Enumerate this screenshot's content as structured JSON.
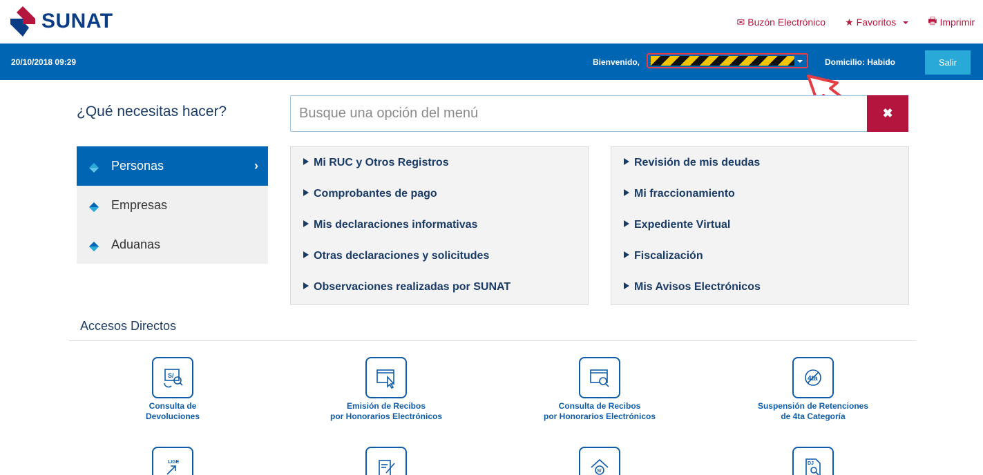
{
  "header": {
    "logo_text": "SUNAT",
    "links": {
      "buzon": "Buzón Electrónico",
      "favoritos": "Favoritos",
      "imprimir": "Imprimir"
    }
  },
  "bar": {
    "datetime": "20/10/2018 09:29",
    "welcome": "Bienvenido,",
    "domicilio": "Domicilio: Habido",
    "logout": "Salir"
  },
  "search": {
    "question": "¿Qué necesitas hacer?",
    "placeholder": "Busque una opción del menú",
    "clear_symbol": "✖"
  },
  "categories": [
    {
      "label": "Personas",
      "active": true
    },
    {
      "label": "Empresas",
      "active": false
    },
    {
      "label": "Aduanas",
      "active": false
    }
  ],
  "options_left": [
    "Mi RUC y Otros Registros",
    "Comprobantes de pago",
    "Mis declaraciones informativas",
    "Otras declaraciones y solicitudes",
    "Observaciones realizadas por SUNAT"
  ],
  "options_right": [
    "Revisión de mis deudas",
    "Mi fraccionamiento",
    "Expediente Virtual",
    "Fiscalización",
    "Mis Avisos Electrónicos"
  ],
  "accesos": {
    "title": "Accesos Directos",
    "tiles": [
      {
        "label": "Consulta de\nDevoluciones",
        "icon": "refund-search-icon"
      },
      {
        "label": "Emisión de Recibos\npor Honorarios Electrónicos",
        "icon": "window-cursor-icon"
      },
      {
        "label": "Consulta de Recibos\npor Honorarios Electrónicos",
        "icon": "window-search-icon"
      },
      {
        "label": "Suspensión de Retenciones\nde 4ta Categoría",
        "icon": "no-4ta-icon"
      }
    ],
    "second_row_icons": [
      {
        "icon": "lige-icon",
        "text": "LIGE"
      },
      {
        "icon": "edit-document-icon"
      },
      {
        "icon": "house-soles-icon",
        "text": "S/"
      },
      {
        "icon": "dj-search-icon",
        "text": "DJ"
      }
    ]
  },
  "colors": {
    "brand_blue": "#0065b3",
    "brand_red": "#b3153f",
    "accent_cyan": "#29a9d8"
  }
}
